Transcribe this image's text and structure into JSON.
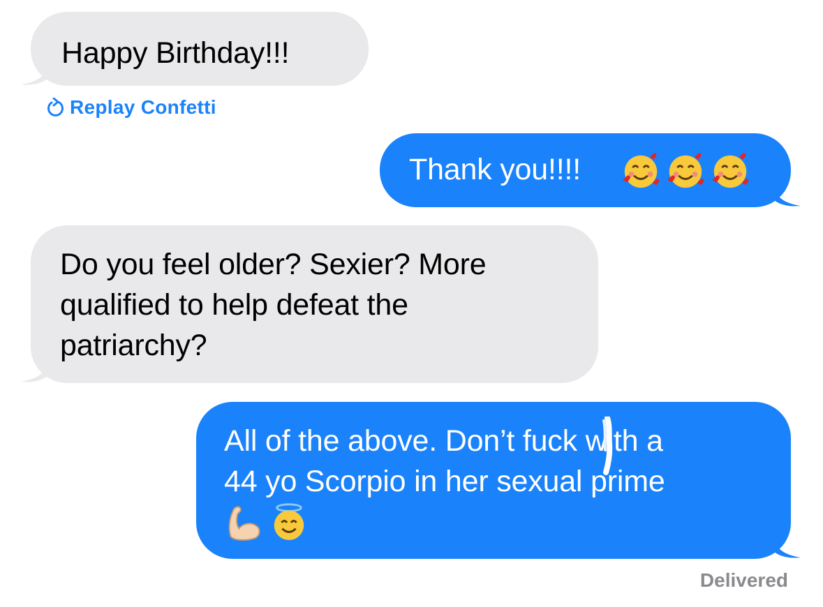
{
  "messages": [
    {
      "direction": "incoming",
      "text": "Happy Birthday!!!"
    },
    {
      "direction": "outgoing",
      "text": "Thank you!!!!",
      "emoji": [
        "smiling-face-with-hearts",
        "smiling-face-with-hearts",
        "smiling-face-with-hearts"
      ]
    },
    {
      "direction": "incoming",
      "lines": [
        "Do you feel older? Sexier? More",
        "qualified to help defeat the",
        "patriarchy?"
      ]
    },
    {
      "direction": "outgoing",
      "lines": [
        "All of the above. Don’t fuck with a",
        "44 yo Scorpio in her sexual prime"
      ],
      "emoji": [
        "flexed-biceps",
        "smiling-face-with-halo"
      ]
    }
  ],
  "effect_action": {
    "label": "Replay Confetti",
    "icon": "replay-icon"
  },
  "status": "Delivered",
  "colors": {
    "incoming_bubble": "#e9e9eb",
    "outgoing_bubble": "#1a82fb",
    "link": "#1a82fb",
    "status_text": "#8a8a8e"
  }
}
